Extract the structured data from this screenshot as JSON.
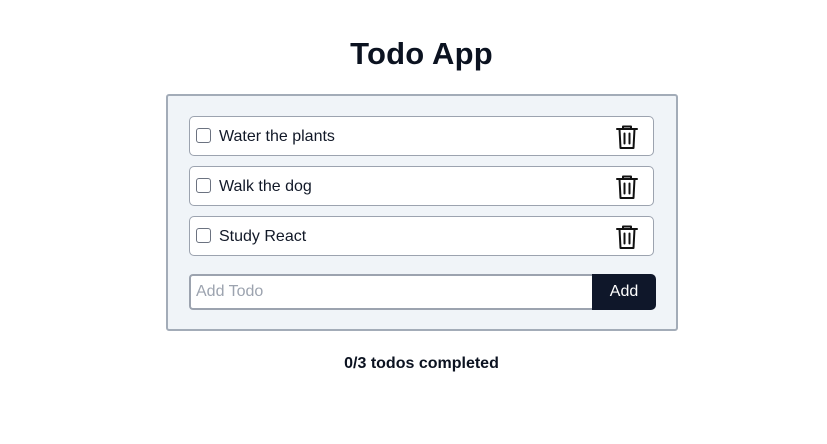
{
  "app": {
    "title": "Todo App"
  },
  "todos": [
    {
      "label": "Water the plants",
      "completed": false
    },
    {
      "label": "Walk the dog",
      "completed": false
    },
    {
      "label": "Study React",
      "completed": false
    }
  ],
  "new_todo": {
    "placeholder": "Add Todo",
    "value": "",
    "add_label": "Add"
  },
  "status": {
    "text": "0/3 todos completed"
  },
  "icons": {
    "delete": "trash-icon",
    "checkbox": "checkbox-unchecked"
  },
  "colors": {
    "panel_background": "#f0f4f8",
    "panel_border": "#a3acb8",
    "button_background": "#0f172a",
    "button_text": "#ffffff"
  }
}
